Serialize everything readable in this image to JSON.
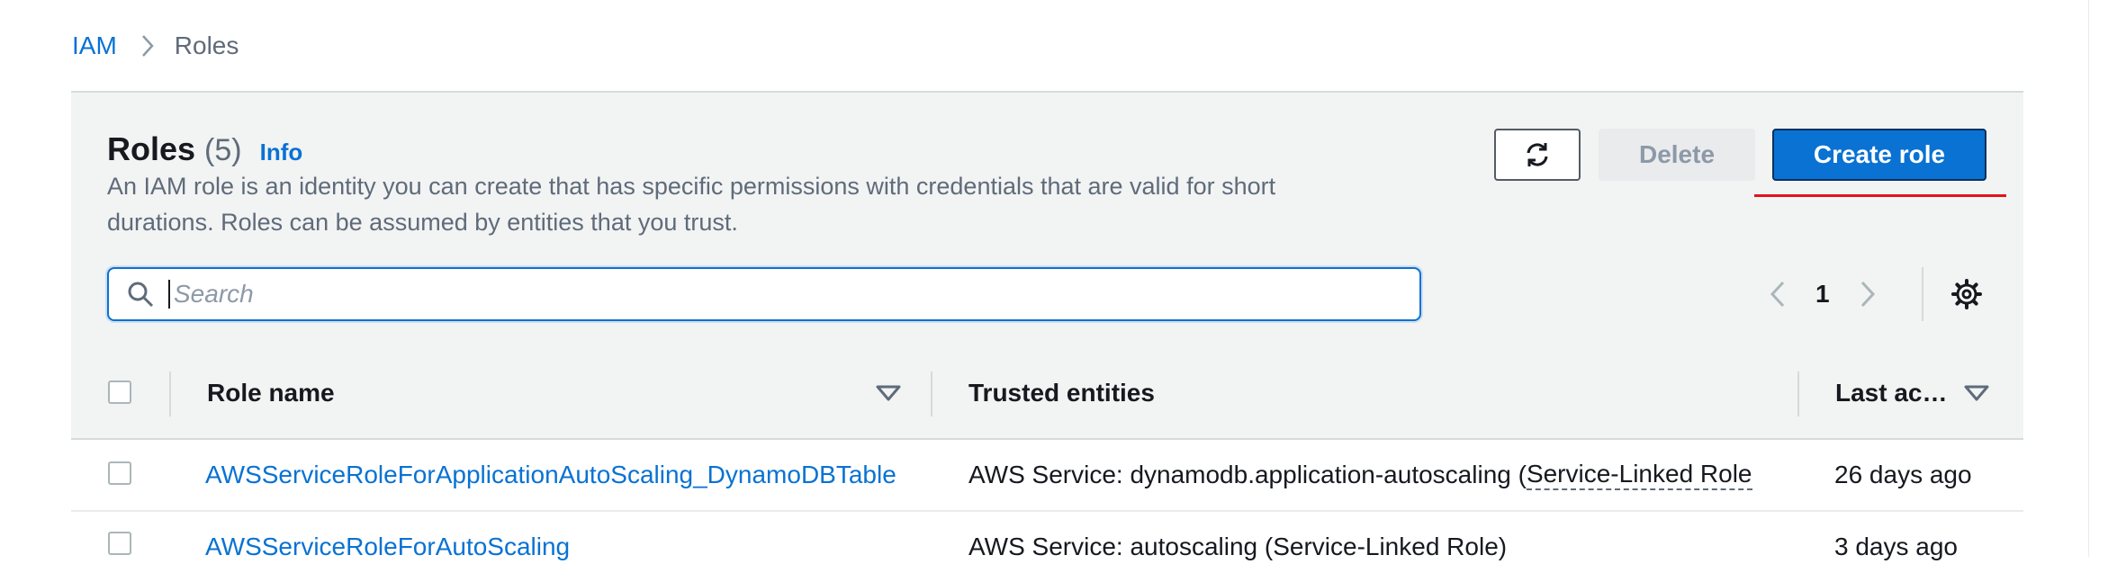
{
  "breadcrumb": {
    "root": "IAM",
    "current": "Roles"
  },
  "header": {
    "title": "Roles",
    "count": "(5)",
    "info_label": "Info",
    "description": "An IAM role is an identity you can create that has specific permissions with credentials that are valid for short durations. Roles can be assumed by entities that you trust."
  },
  "toolbar": {
    "refresh_icon": "refresh-icon",
    "delete_label": "Delete",
    "create_label": "Create role",
    "accent_color": "#0972d3",
    "highlight_color": "#e0141e"
  },
  "search": {
    "placeholder": "Search",
    "value": ""
  },
  "pagination": {
    "current_page": "1"
  },
  "table": {
    "columns": [
      "Role name",
      "Trusted entities",
      "Last ac…"
    ],
    "rows": [
      {
        "role_name": "AWSServiceRoleForApplicationAutoScaling_DynamoDBTable",
        "trusted_prefix": "AWS Service: dynamodb.application-autoscaling (",
        "trusted_linked": "Service-Linked Role",
        "last_activity": "26 days ago"
      },
      {
        "role_name": "AWSServiceRoleForAutoScaling",
        "trusted_prefix": "AWS Service: autoscaling (Service-Linked Role)",
        "trusted_linked": "",
        "last_activity": "3 days ago"
      }
    ]
  }
}
